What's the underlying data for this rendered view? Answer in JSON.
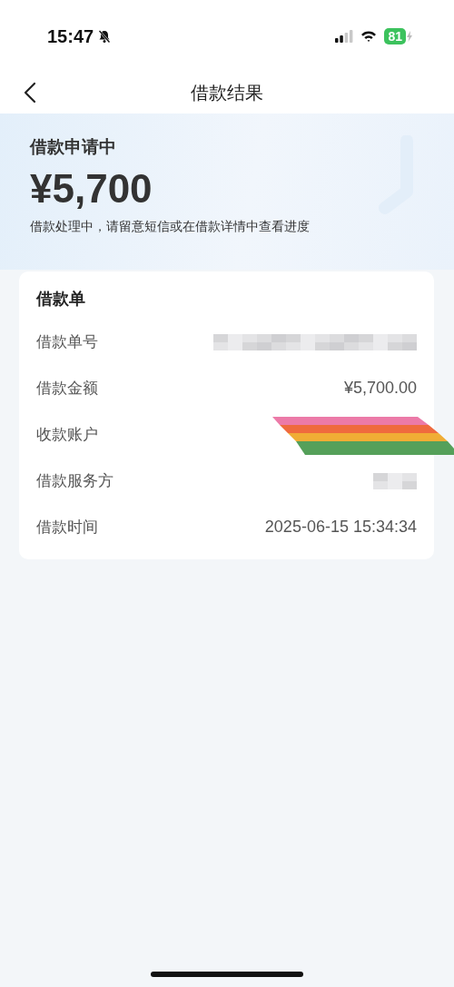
{
  "status_bar": {
    "time": "15:47",
    "battery": "81"
  },
  "nav": {
    "title": "借款结果"
  },
  "hero": {
    "status": "借款申请中",
    "amount": "¥5,700",
    "note": "借款处理中，请留意短信或在借款详情中查看进度"
  },
  "card": {
    "title": "借款单",
    "rows": [
      {
        "label": "借款单号",
        "kind": "redacted"
      },
      {
        "label": "借款金额",
        "kind": "text",
        "value": "¥5,700.00"
      },
      {
        "label": "收款账户",
        "kind": "scribble"
      },
      {
        "label": "借款服务方",
        "kind": "redacted_short"
      },
      {
        "label": "借款时间",
        "kind": "text",
        "value": "2025-06-15 15:34:34"
      }
    ]
  }
}
